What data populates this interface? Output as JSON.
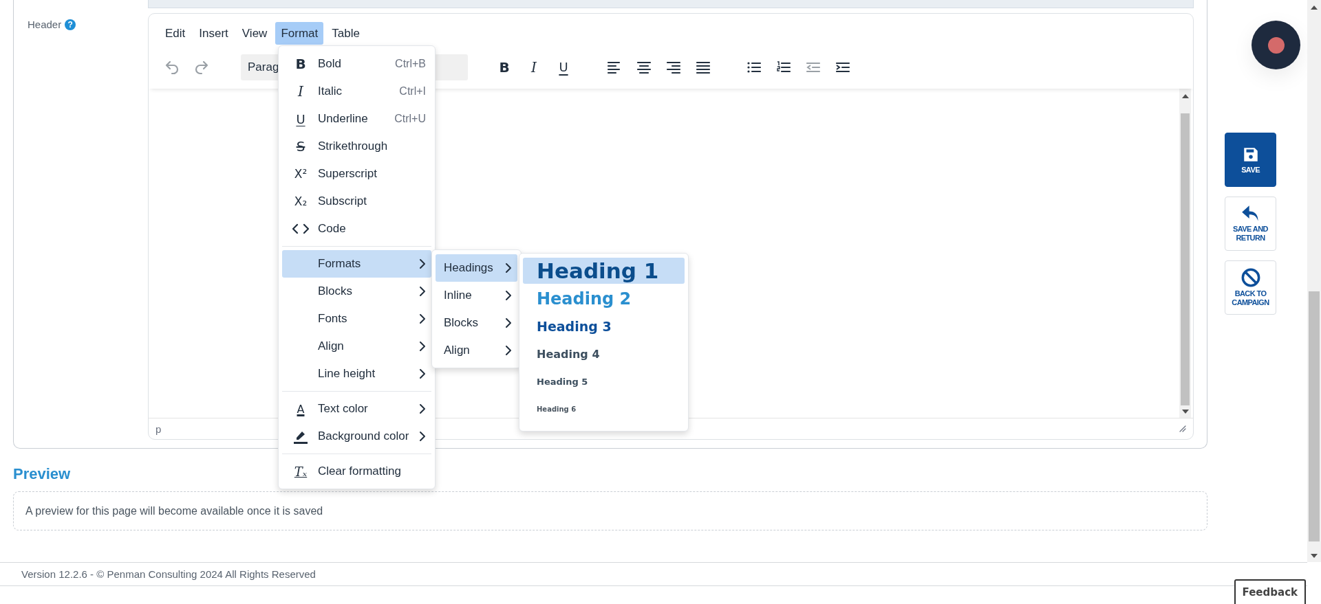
{
  "header_field": {
    "label": "Header",
    "help_glyph": "?"
  },
  "editor": {
    "menubar": [
      {
        "label": "Edit",
        "selected": false
      },
      {
        "label": "Insert",
        "selected": false
      },
      {
        "label": "View",
        "selected": false
      },
      {
        "label": "Format",
        "selected": true
      },
      {
        "label": "Table",
        "selected": false
      }
    ],
    "toolbar_groups": [
      [
        {
          "kind": "undo",
          "disabled": true
        },
        {
          "kind": "redo",
          "disabled": true
        }
      ],
      [
        {
          "kind": "select",
          "value": "Parag"
        }
      ],
      [
        {
          "kind": "glyph",
          "glyph": "B",
          "disabled": false
        },
        {
          "kind": "glyph",
          "glyph": "I",
          "disabled": false
        },
        {
          "kind": "glyph",
          "glyph": "U",
          "disabled": false
        }
      ],
      [
        {
          "kind": "align-left",
          "disabled": false
        },
        {
          "kind": "align-center",
          "disabled": false
        },
        {
          "kind": "align-right",
          "disabled": false
        },
        {
          "kind": "align-justify",
          "disabled": false
        }
      ],
      [
        {
          "kind": "bullet-list",
          "disabled": false
        },
        {
          "kind": "numbered-list",
          "disabled": false
        },
        {
          "kind": "outdent",
          "disabled": true
        },
        {
          "kind": "indent",
          "disabled": false
        }
      ]
    ],
    "status_path": "p"
  },
  "format_menu": {
    "items": [
      {
        "kind": "command",
        "glyph": "B",
        "label": "Bold",
        "shortcut": "Ctrl+B"
      },
      {
        "kind": "command",
        "glyph": "I",
        "label": "Italic",
        "shortcut": "Ctrl+I"
      },
      {
        "kind": "command",
        "glyph": "U",
        "label": "Underline",
        "shortcut": "Ctrl+U"
      },
      {
        "kind": "command",
        "glyph": "S",
        "label": "Strikethrough"
      },
      {
        "kind": "command",
        "glyph": "X²",
        "label": "Superscript"
      },
      {
        "kind": "command",
        "glyph": "X₂",
        "label": "Subscript"
      },
      {
        "kind": "command",
        "label": "Code"
      },
      {
        "kind": "separator"
      },
      {
        "kind": "submenu",
        "label": "Formats",
        "selected": true
      },
      {
        "kind": "submenu",
        "label": "Blocks",
        "selected": false
      },
      {
        "kind": "submenu",
        "label": "Fonts",
        "selected": false
      },
      {
        "kind": "submenu",
        "label": "Align",
        "selected": false
      },
      {
        "kind": "submenu",
        "label": "Line height",
        "selected": false
      },
      {
        "kind": "separator"
      },
      {
        "kind": "submenu",
        "glyph": "A",
        "label": "Text color",
        "selected": false
      },
      {
        "kind": "submenu",
        "label": "Background color",
        "selected": false
      },
      {
        "kind": "separator"
      },
      {
        "kind": "command",
        "glyph": "Tₓ",
        "label": "Clear formatting"
      }
    ]
  },
  "formats_menu": {
    "items": [
      {
        "label": "Headings",
        "selected": true
      },
      {
        "label": "Inline",
        "selected": false
      },
      {
        "label": "Blocks",
        "selected": false
      },
      {
        "label": "Align",
        "selected": false
      }
    ]
  },
  "headings_menu": {
    "items": [
      {
        "label": "Heading 1",
        "selected": true
      },
      {
        "label": "Heading 2",
        "selected": false
      },
      {
        "label": "Heading 3",
        "selected": false
      },
      {
        "label": "Heading 4",
        "selected": false
      },
      {
        "label": "Heading 5",
        "selected": false
      },
      {
        "label": "Heading 6",
        "selected": false
      }
    ]
  },
  "preview": {
    "title": "Preview",
    "message": "A preview for this page will become available once it is saved"
  },
  "footer": "Version 12.2.6 - © Penman Consulting 2024 All Rights Reserved",
  "side_actions": [
    {
      "kind": "primary",
      "label": "SAVE"
    },
    {
      "kind": "secondary",
      "label": "SAVE AND RETURN"
    },
    {
      "kind": "secondary",
      "label": "BACK TO CAMPAIGN"
    }
  ],
  "feedback": "Feedback"
}
